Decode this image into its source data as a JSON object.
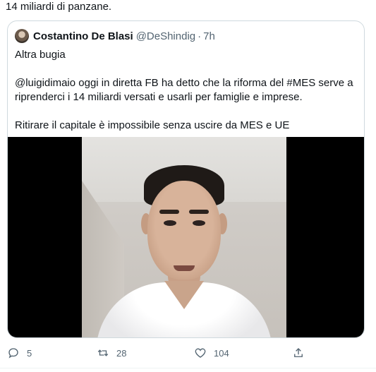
{
  "tweet": {
    "text_top": "14 miliardi di panzane."
  },
  "quote": {
    "author_name": "Costantino De Blasi",
    "handle": "@DeShindig",
    "separator": "·",
    "time": "7h",
    "lines": [
      "Altra bugia",
      "@luigidimaio oggi in diretta FB ha detto che la riforma del #MES serve a riprenderci i 14 miliardi versati e usarli per famiglie e imprese.",
      "Ritirare il capitale è impossibile senza uscire da MES e UE"
    ]
  },
  "actions": {
    "reply_count": "5",
    "retweet_count": "28",
    "like_count": "104",
    "icons": [
      "reply-icon",
      "retweet-icon",
      "like-icon",
      "share-icon"
    ]
  },
  "colors": {
    "text_primary": "#0f1419",
    "text_secondary": "#536471",
    "border": "#cfd9de"
  }
}
